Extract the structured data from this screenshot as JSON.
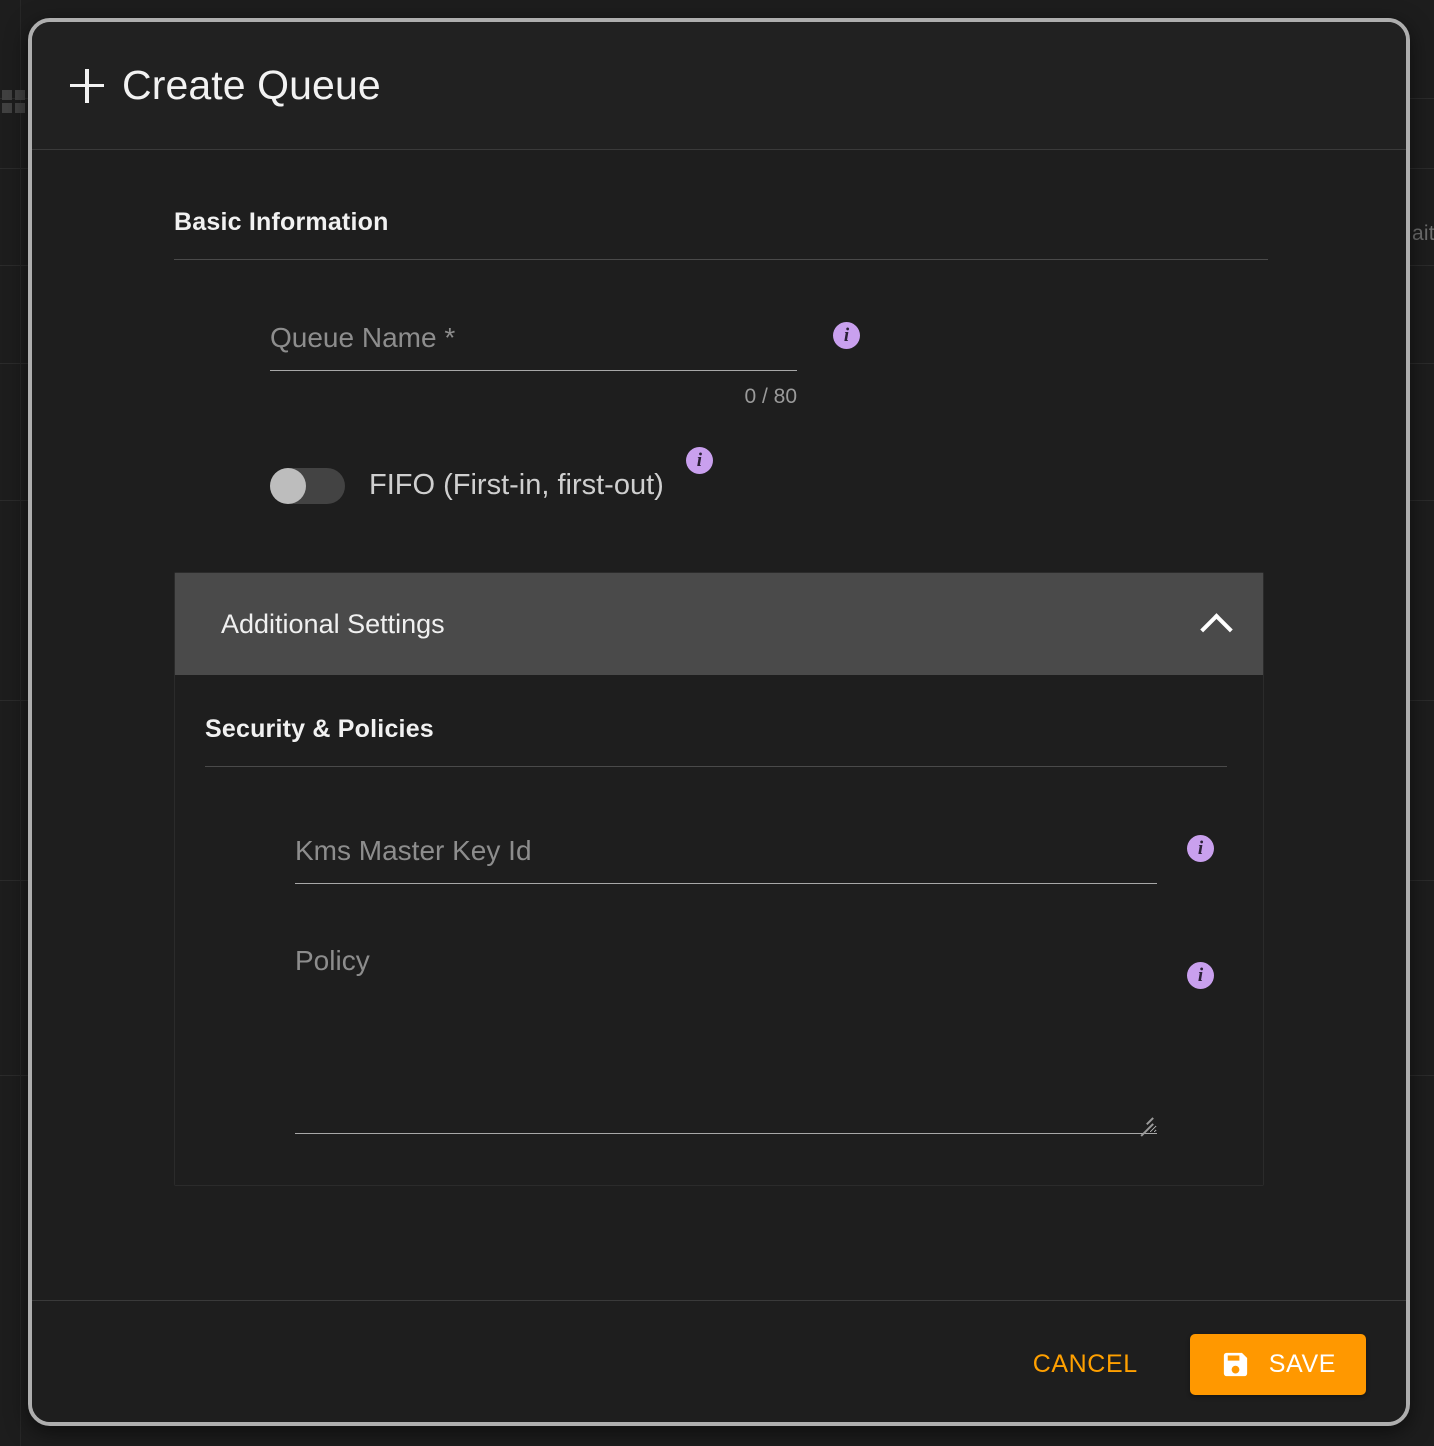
{
  "background": {
    "partial_text": "ait",
    "apps_icon": "apps-grid-icon"
  },
  "dialog": {
    "title": "Create Queue",
    "add_icon": "plus-icon",
    "basic_information": {
      "heading": "Basic Information",
      "queue_name": {
        "placeholder": "Queue Name *",
        "value": "",
        "char_counter": "0 / 80",
        "info_icon": "info-icon"
      },
      "fifo": {
        "label": "FIFO (First-in, first-out)",
        "state": "off",
        "info_icon": "info-icon"
      }
    },
    "additional_settings": {
      "label": "Additional Settings",
      "expanded": true,
      "toggle_icon": "chevron-up-icon",
      "security_policies": {
        "heading": "Security & Policies",
        "kms_master_key_id": {
          "placeholder": "Kms Master Key Id",
          "value": "",
          "info_icon": "info-icon"
        },
        "policy": {
          "placeholder": "Policy",
          "value": "",
          "info_icon": "info-icon"
        }
      }
    },
    "footer": {
      "cancel_label": "CANCEL",
      "save_label": "SAVE",
      "save_icon": "save-floppy-icon"
    }
  },
  "colors": {
    "accent_orange": "#ff9800",
    "cancel_orange": "#ffa000",
    "info_purple": "#c9a0ee",
    "dialog_background": "#1e1e1e",
    "expander_background": "#4a4a4a",
    "dialog_border": "#aeaeae"
  }
}
